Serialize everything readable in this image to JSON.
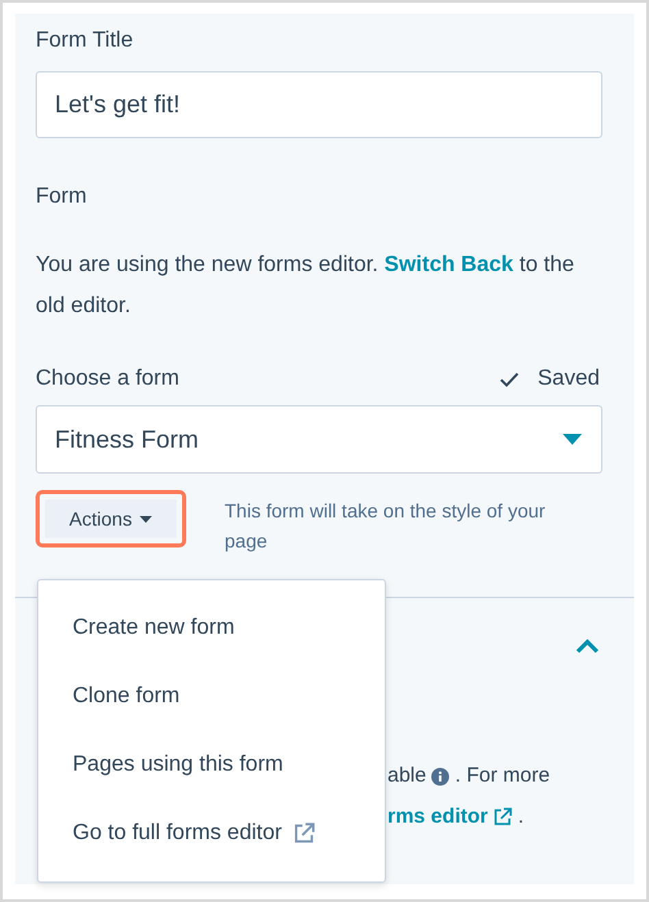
{
  "form_title": {
    "label": "Form Title",
    "value": "Let's get fit!"
  },
  "form_section": {
    "heading": "Form",
    "notice_before": "You are using the new forms editor.",
    "notice_link": "Switch Back",
    "notice_after": "to the old editor."
  },
  "choose": {
    "label": "Choose a form",
    "saved": true,
    "status": "Saved",
    "value": "Fitness Form"
  },
  "actions": {
    "label": "Actions",
    "highlighted": true,
    "hint": "This form will take on the style of your page"
  },
  "menu": {
    "open": true,
    "items": [
      {
        "label": "Create new form",
        "external": false
      },
      {
        "label": "Clone form",
        "external": false
      },
      {
        "label": "Pages using this form",
        "external": false
      },
      {
        "label": "Go to full forms editor",
        "external": true
      }
    ]
  },
  "lower_section": {
    "expanded": true,
    "line_1": "able",
    "line_1_end": ". For more",
    "line_2_link": "rms editor",
    "line_2_end": "."
  }
}
